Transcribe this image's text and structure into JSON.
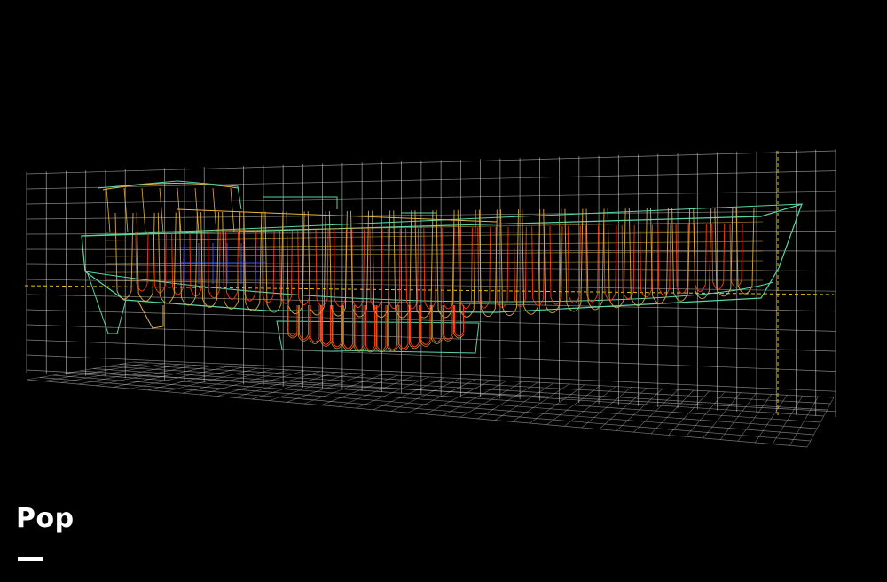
{
  "caption": {
    "title": "Pop"
  },
  "colors": {
    "background": "#000000",
    "grid": "#d8d8d8",
    "guide": "#e6c400",
    "hull_outline": "#58d6a4",
    "frames_outer": "#e8b640",
    "frames_inner": "#ff3a12",
    "structure_blue": "#3a5cff",
    "caption_text": "#ffffff"
  }
}
